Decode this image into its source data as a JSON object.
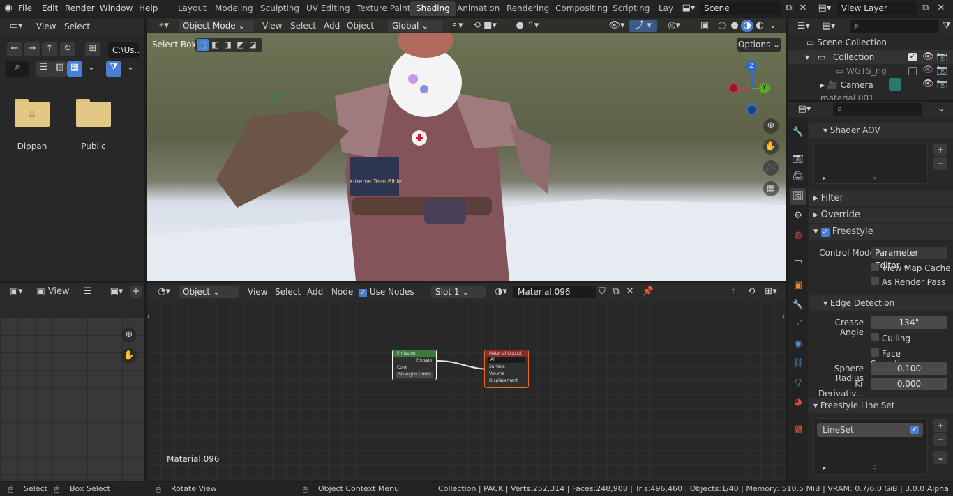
{
  "topbar": {
    "menus": [
      "File",
      "Edit",
      "Render",
      "Window",
      "Help"
    ],
    "tabs": [
      "Layout",
      "Modeling",
      "Sculpting",
      "UV Editing",
      "Texture Paint",
      "Shading",
      "Animation",
      "Rendering",
      "Compositing",
      "Scripting",
      "Lay"
    ],
    "active_tab": "Shading",
    "scene": "Scene",
    "view_layer": "View Layer"
  },
  "file_browser": {
    "menus": [
      "View",
      "Select"
    ],
    "path": "C:\\Us...",
    "folders": [
      "Dippan",
      "Public"
    ]
  },
  "viewport": {
    "mode": "Object Mode",
    "menus": [
      "View",
      "Select",
      "Add",
      "Object"
    ],
    "transform": "Global",
    "tool_label": "Select Box",
    "options_label": "Options",
    "book_text": "X-treme Teen Bible"
  },
  "node_editor": {
    "type": "Object",
    "menus": [
      "View",
      "Select",
      "Add",
      "Node"
    ],
    "use_nodes_label": "Use Nodes",
    "slot": "Slot 1",
    "material": "Material.096",
    "footer_material": "Material.096",
    "nodes": {
      "emission": {
        "title": "Emission",
        "out": "Emissio",
        "color": "Color",
        "strength_label": "Strength",
        "strength": "1.000"
      },
      "output": {
        "title": "Material Output",
        "target": "All",
        "surface": "Surface",
        "volume": "Volume",
        "displacement": "Displacement"
      }
    }
  },
  "image_editor": {
    "view": "View"
  },
  "outliner": {
    "scene_collection": "Scene Collection",
    "items": [
      "Collection",
      "WGTS_rig",
      "Camera",
      "material.001"
    ]
  },
  "properties": {
    "shader_aov": "Shader AOV",
    "filter": "Filter",
    "override": "Override",
    "freestyle": "Freestyle",
    "control_mode_label": "Control Mode",
    "control_mode": "Parameter Editor",
    "view_map_cache": "View Map Cache",
    "as_render_pass": "As Render Pass",
    "edge_detection": "Edge Detection",
    "crease_angle_label": "Crease Angle",
    "crease_angle": "134°",
    "culling": "Culling",
    "face_smoothness": "Face Smoothness",
    "sphere_radius_label": "Sphere Radius",
    "sphere_radius": "0.100",
    "kr_label": "Kr Derivativ...",
    "kr_value": "0.000",
    "line_set_panel": "Freestyle Line Set",
    "lineset": "LineSet"
  },
  "statusbar": {
    "select": "Select",
    "box_select": "Box Select",
    "rotate_view": "Rotate View",
    "context_menu": "Object Context Menu",
    "stats": "Collection | PACK | Verts:252,314 | Faces:248,908 | Tris:496,460 | Objects:1/40 | Memory: 510.5 MiB | VRAM: 0.7/6.0 GiB | 3.0.0 Alpha"
  },
  "colors": {
    "accent": "#4a7fd4",
    "bg": "#1d1d1d",
    "panel": "#2b2b2b"
  }
}
